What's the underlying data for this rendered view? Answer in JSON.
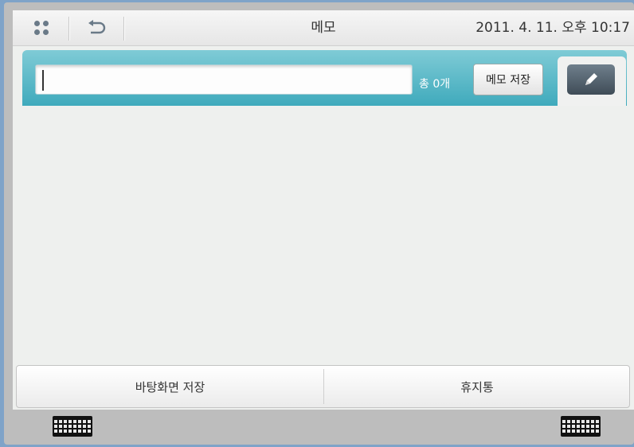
{
  "header": {
    "title": "메모",
    "datetime": "2011. 4. 11. 오후 10:17"
  },
  "toolbar": {
    "memo_input_value": "",
    "count_label": "총 0개",
    "save_label": "메모 저장"
  },
  "bottom": {
    "wallpaper_save_label": "바탕화면 저장",
    "trash_label": "휴지통"
  },
  "icons": [
    "apps-grid-icon",
    "back-icon",
    "pencil-icon",
    "keyboard-icon"
  ],
  "colors": {
    "accent": "#3faabc",
    "frame": "#bdbdbd",
    "background": "#7fa3c8"
  }
}
